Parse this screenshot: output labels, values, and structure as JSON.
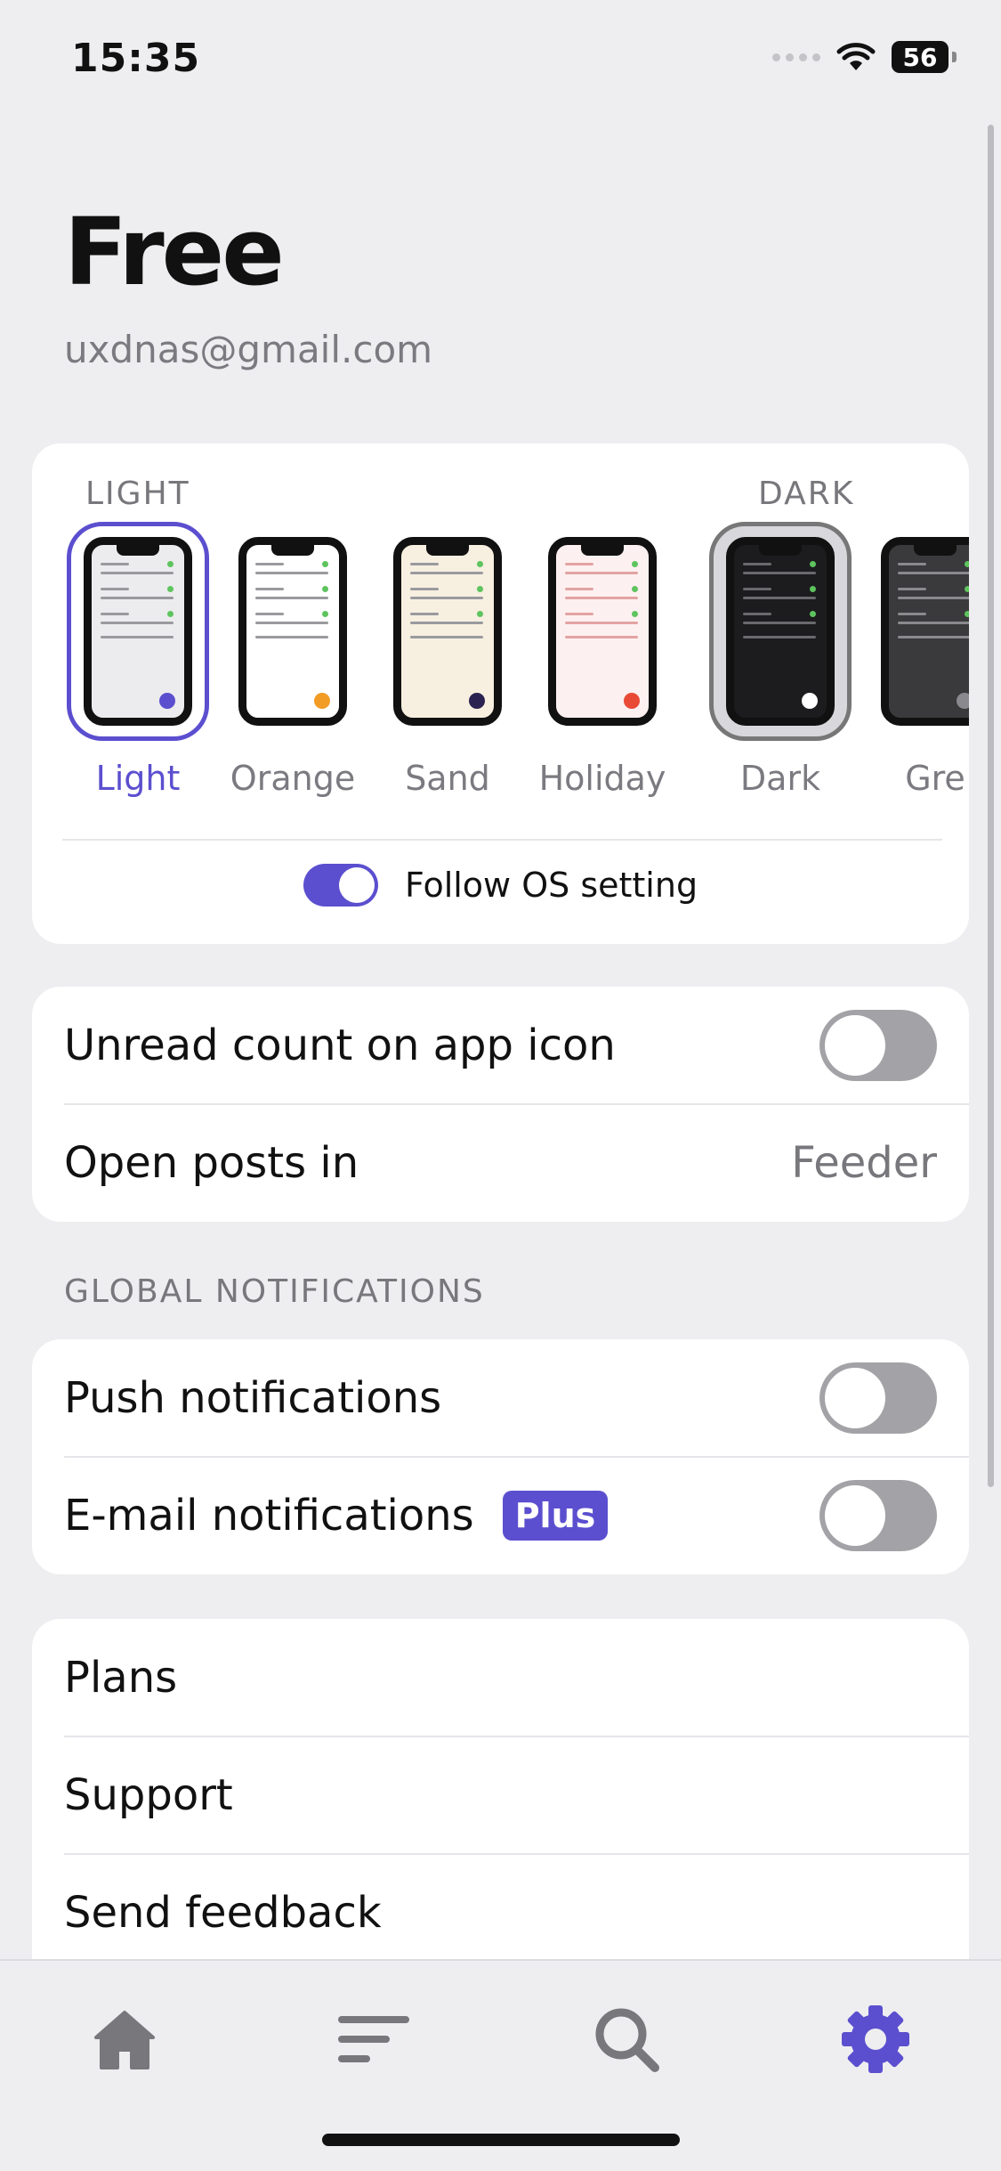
{
  "status": {
    "time": "15:35",
    "battery": "56"
  },
  "account": {
    "plan": "Free",
    "email": "uxdnas@gmail.com"
  },
  "themes": {
    "light_label": "LIGHT",
    "dark_label": "DARK",
    "items": [
      {
        "name": "Light",
        "screen": "#ececee",
        "lines": "#9a9a9e",
        "dot": "#5b4fcf"
      },
      {
        "name": "Orange",
        "screen": "#ffffff",
        "lines": "#9a9a9e",
        "dot": "#f29c26"
      },
      {
        "name": "Sand",
        "screen": "#f7efe0",
        "lines": "#9a9a9e",
        "dot": "#2a2250"
      },
      {
        "name": "Holiday",
        "screen": "#fdf0f0",
        "lines": "#e2a3a3",
        "dot": "#e84a36"
      },
      {
        "name": "Dark",
        "screen": "#1c1c1e",
        "lines": "#6a6a6e",
        "dot": "#ffffff"
      },
      {
        "name": "Gre",
        "screen": "#3a3a3c",
        "lines": "#8a8a8e",
        "dot": "#8a8a8e"
      }
    ],
    "selected": "Light",
    "follow_os_label": "Follow OS setting",
    "follow_os_on": true
  },
  "general": {
    "unread_label": "Unread count on app icon",
    "unread_on": false,
    "open_posts_label": "Open posts in",
    "open_posts_value": "Feeder"
  },
  "notifications": {
    "header": "GLOBAL NOTIFICATIONS",
    "push_label": "Push notifications",
    "push_on": false,
    "email_label": "E-mail notifications",
    "email_badge": "Plus",
    "email_on": false
  },
  "links": {
    "plans": "Plans",
    "support": "Support",
    "feedback": "Send feedback"
  },
  "tabs": {
    "icons": [
      "home-icon",
      "list-icon",
      "search-icon",
      "gear-icon"
    ],
    "active": "settings",
    "active_color": "#5b4fcf",
    "inactive_color": "#77777c"
  }
}
